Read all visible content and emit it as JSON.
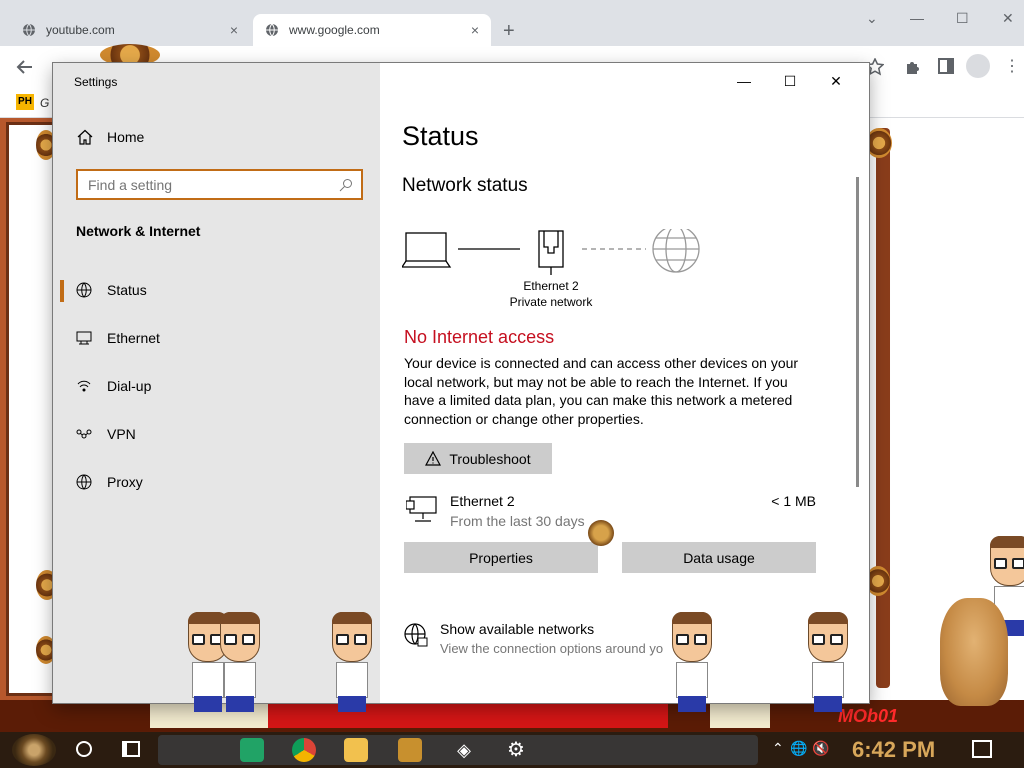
{
  "browser": {
    "tabs": [
      {
        "title": "youtube.com",
        "close": "×"
      },
      {
        "title": "www.google.com",
        "close": "×"
      }
    ],
    "new_tab": "+",
    "bookmark_badge": "PH",
    "bookmark_text": "G"
  },
  "settings": {
    "window_title": "Settings",
    "controls": {
      "minimize": "—",
      "maximize": "☐",
      "close": "✕"
    },
    "nav": {
      "home": "Home",
      "search_placeholder": "Find a setting",
      "section": "Network & Internet",
      "items": [
        {
          "label": "Status",
          "icon": "status-globe-icon",
          "selected": true
        },
        {
          "label": "Ethernet",
          "icon": "ethernet-icon",
          "selected": false
        },
        {
          "label": "Dial-up",
          "icon": "dialup-icon",
          "selected": false
        },
        {
          "label": "VPN",
          "icon": "vpn-icon",
          "selected": false
        },
        {
          "label": "Proxy",
          "icon": "proxy-globe-icon",
          "selected": false
        }
      ]
    },
    "content": {
      "title": "Status",
      "subtitle": "Network status",
      "adapter_name": "Ethernet 2",
      "network_type": "Private network",
      "status_heading": "No Internet access",
      "status_description": "Your device is connected and can access other devices on your local network, but may not be able to reach the Internet. If you have a limited data plan, you can make this network a metered connection or change other properties.",
      "troubleshoot_label": "Troubleshoot",
      "connection": {
        "name": "Ethernet 2",
        "period": "From the last 30 days",
        "usage": "< 1 MB"
      },
      "properties_label": "Properties",
      "data_usage_label": "Data usage",
      "available": {
        "title": "Show available networks",
        "subtitle": "View the connection options around yo"
      }
    },
    "colors": {
      "accent": "#c16c16",
      "error": "#c50f1f",
      "button": "#cccccc",
      "nav_bg": "#e6e6e6"
    }
  },
  "banner": {
    "text": "MOb01"
  },
  "taskbar": {
    "time": "6:42 PM",
    "apps": [
      "spreadsheet-app-icon",
      "chrome-icon",
      "file-explorer-icon",
      "game-app-icon",
      "unity-icon",
      "settings-gear-icon"
    ]
  }
}
